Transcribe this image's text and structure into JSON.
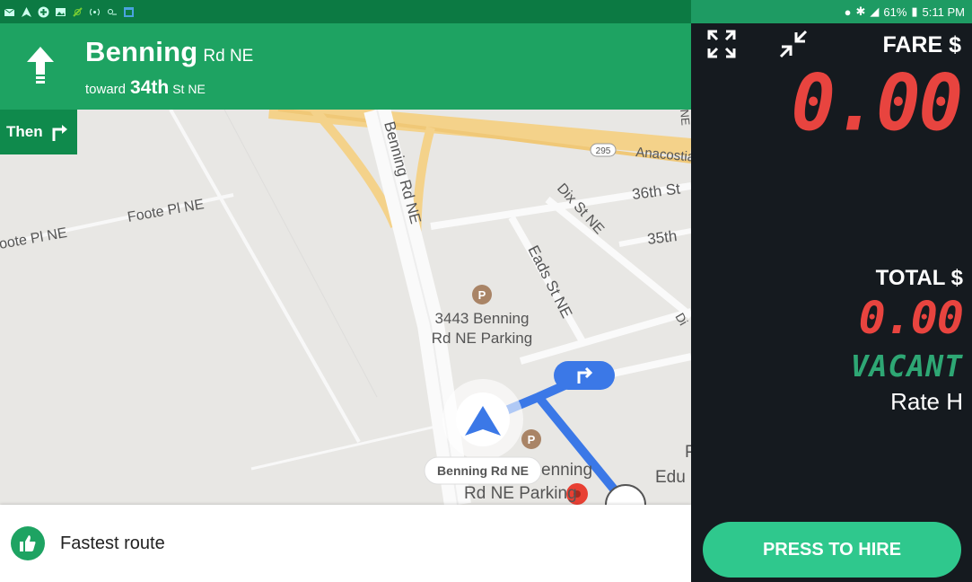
{
  "nav": {
    "maneuver_icon": "straight-arrow-icon",
    "street_main": "Benning",
    "street_suffix": "Rd NE",
    "toward_word": "toward",
    "toward_main": "34th",
    "toward_suffix": "St NE",
    "then_label": "Then",
    "then_icon": "turn-right-icon",
    "route_summary": "Fastest route",
    "route_icon": "thumbs-up-icon",
    "brand_color": "#1ea362"
  },
  "map": {
    "labels": {
      "foote_1": "Foote Pl NE",
      "foote_2": "oote Pl NE",
      "benning": "Benning Rd NE",
      "dix": "Dix St NE",
      "eads": "Eads St NE",
      "st36": "36th St",
      "st35": "35th",
      "anacostia": "Anacostia",
      "i295": "295",
      "parking_1": "3443 Benning",
      "parking_2": "Rd NE Parking",
      "parking2_1": "enning",
      "parking2_2": "Rd NE Parking",
      "edu_1": "P",
      "edu_2": "Edu",
      "di": "Di",
      "ne": "NE"
    },
    "current_street_chip": "Benning Rd NE"
  },
  "meter": {
    "statusbar": {
      "battery": "61%",
      "time": "5:11 PM"
    },
    "fare_label": "FARE $",
    "fare_value": "0.00",
    "total_label": "TOTAL $",
    "total_value": "0.00",
    "status": "VACANT",
    "rate": "Rate H",
    "hire_button": "PRESS TO HIRE",
    "fare_color": "#e8443f",
    "status_color": "#2ea774",
    "button_color": "#2fc88d"
  }
}
